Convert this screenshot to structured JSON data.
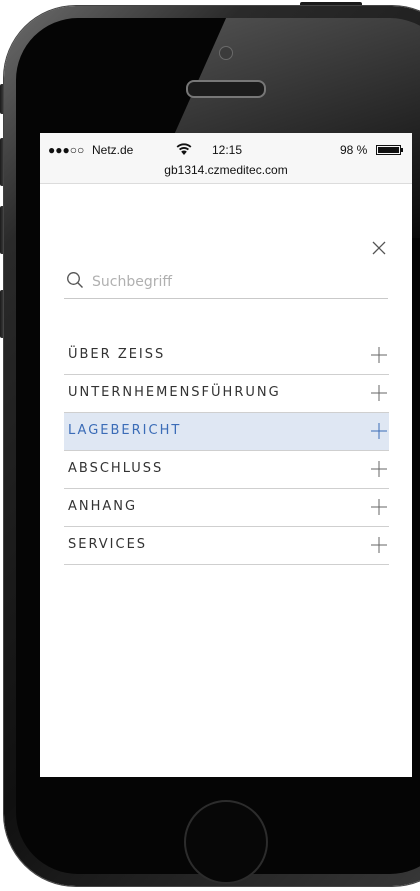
{
  "status_bar": {
    "signal": "●●●○○",
    "carrier": "Netz.de",
    "time": "12:15",
    "battery_percent": "98 %",
    "url": "gb1314.czmeditec.com",
    "wifi_icon": "wifi-icon",
    "battery_icon": "battery-icon"
  },
  "close_icon": "close-icon",
  "search": {
    "placeholder": "Suchbegriff",
    "value": "",
    "icon": "search-icon"
  },
  "menu": {
    "active_color": "#3b6cb7",
    "active_background": "#dfe7f3",
    "items": [
      {
        "label": "ÜBER ZEISS",
        "active": false
      },
      {
        "label": "UNTERNHEMENSFÜHRUNG",
        "active": false
      },
      {
        "label": "LAGEBERICHT",
        "active": true
      },
      {
        "label": "ABSCHLUSS",
        "active": false
      },
      {
        "label": "ANHANG",
        "active": false
      },
      {
        "label": "SERVICES",
        "active": false
      }
    ]
  }
}
